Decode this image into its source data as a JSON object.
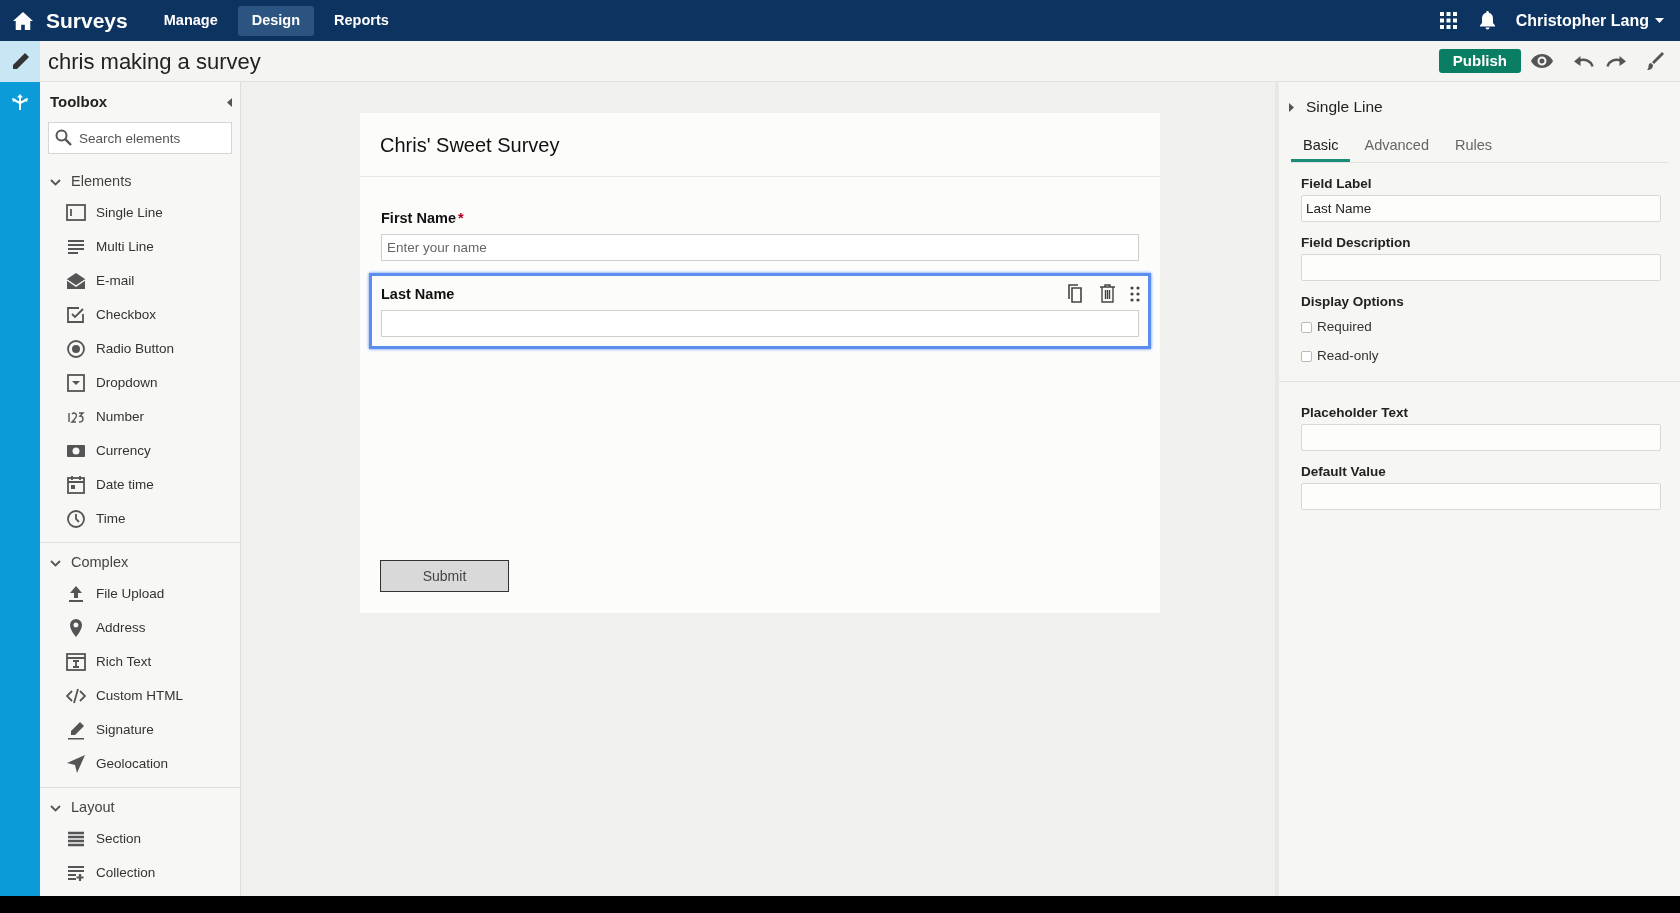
{
  "app_bar": {
    "title": "Surveys",
    "nav": [
      {
        "label": "Manage",
        "selected": false
      },
      {
        "label": "Design",
        "selected": true
      },
      {
        "label": "Reports",
        "selected": false
      }
    ],
    "user": "Christopher Lang"
  },
  "rail": [
    {
      "selected": true
    },
    {
      "selected": false
    }
  ],
  "page_title": "chris making a survey",
  "publish": "Publish",
  "toolbox": {
    "title": "Toolbox",
    "search_placeholder": "Search elements",
    "groups": [
      {
        "label": "Elements",
        "expanded": true,
        "items": [
          "Single Line",
          "Multi Line",
          "E-mail",
          "Checkbox",
          "Radio Button",
          "Dropdown",
          "Number",
          "Currency",
          "Date time",
          "Time"
        ]
      },
      {
        "label": "Complex",
        "expanded": true,
        "items": [
          "File Upload",
          "Address",
          "Rich Text",
          "Custom HTML",
          "Signature",
          "Geolocation"
        ]
      },
      {
        "label": "Layout",
        "expanded": true,
        "items": [
          "Section",
          "Collection"
        ]
      }
    ]
  },
  "form": {
    "title": "Chris' Sweet Survey",
    "fields": [
      {
        "label": "First Name",
        "required_mark": "*",
        "placeholder": "Enter your name",
        "selected": false
      },
      {
        "label": "Last Name",
        "selected": true
      }
    ],
    "submit": "Submit"
  },
  "properties": {
    "title": "Single Line",
    "tabs": [
      {
        "label": "Basic",
        "selected": true
      },
      {
        "label": "Advanced",
        "selected": false
      },
      {
        "label": "Rules",
        "selected": false
      }
    ],
    "sections": [
      [
        {
          "kind": "text",
          "label": "Field Label",
          "value": "Last Name"
        },
        {
          "kind": "text",
          "label": "Field Description"
        },
        {
          "kind": "checks",
          "label": "Display Options",
          "options": [
            {
              "label": "Required",
              "checked": false
            },
            {
              "label": "Read-only",
              "checked": false
            }
          ]
        }
      ],
      [
        {
          "kind": "text",
          "label": "Placeholder Text"
        },
        {
          "kind": "text",
          "label": "Default Value"
        }
      ]
    ]
  }
}
